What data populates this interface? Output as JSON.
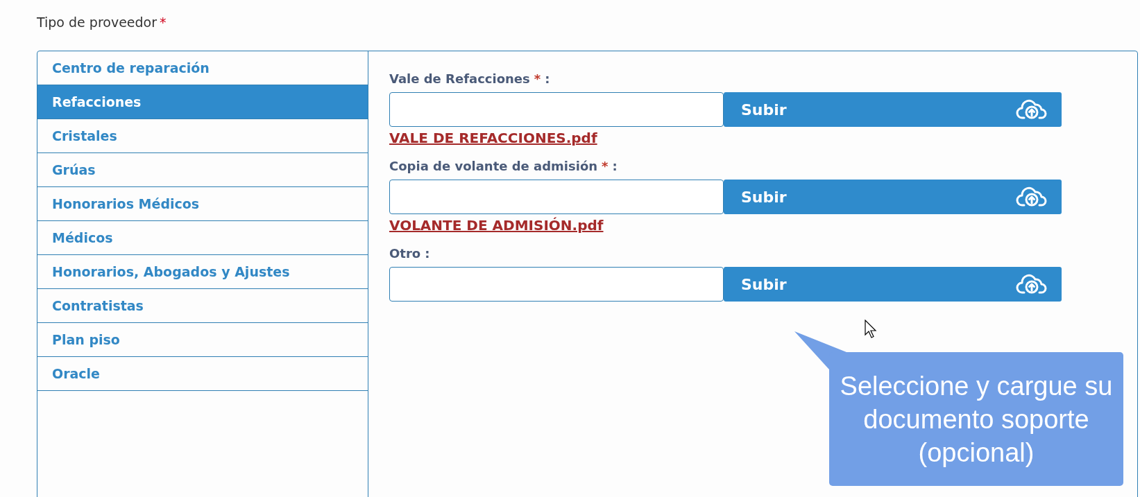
{
  "provider_type": {
    "label": "Tipo de proveedor",
    "required_mark": "*"
  },
  "sidebar": {
    "items": [
      {
        "label": "Centro de reparación",
        "selected": false
      },
      {
        "label": "Refacciones",
        "selected": true
      },
      {
        "label": "Cristales",
        "selected": false
      },
      {
        "label": "Grúas",
        "selected": false
      },
      {
        "label": "Honorarios Médicos",
        "selected": false
      },
      {
        "label": "Médicos",
        "selected": false
      },
      {
        "label": "Honorarios, Abogados y Ajustes",
        "selected": false
      },
      {
        "label": "Contratistas",
        "selected": false
      },
      {
        "label": "Plan piso",
        "selected": false
      },
      {
        "label": "Oracle",
        "selected": false
      }
    ]
  },
  "uploads": [
    {
      "label": "Vale de Refacciones",
      "required_mark": "*",
      "colon": ":",
      "button": "Subir",
      "file": "VALE DE REFACCIONES.pdf"
    },
    {
      "label": "Copia de volante de admisión",
      "required_mark": "*",
      "colon": ":",
      "button": "Subir",
      "file": "VOLANTE DE ADMISIÓN.pdf"
    },
    {
      "label": "Otro",
      "colon": ":",
      "button": "Subir"
    }
  ],
  "callout": {
    "text": "Seleccione y cargue su documento soporte (opcional)"
  }
}
